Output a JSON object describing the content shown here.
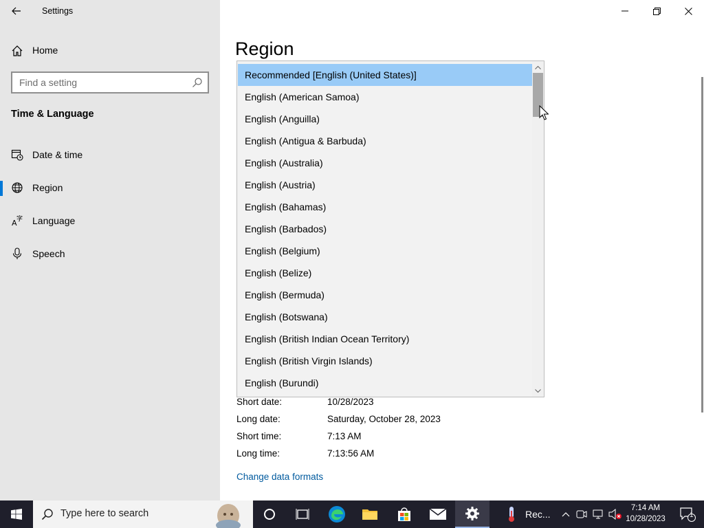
{
  "window": {
    "app_title": "Settings",
    "controls": {
      "minimize_icon": "minimize-icon",
      "maximize_icon": "restore-icon",
      "close_icon": "close-icon"
    }
  },
  "sidebar": {
    "home_label": "Home",
    "search_placeholder": "Find a setting",
    "section_title": "Time & Language",
    "items": [
      {
        "label": "Date & time",
        "icon": "calendar-clock-icon",
        "selected": false
      },
      {
        "label": "Region",
        "icon": "globe-icon",
        "selected": true
      },
      {
        "label": "Language",
        "icon": "language-icon",
        "selected": false
      },
      {
        "label": "Speech",
        "icon": "microphone-icon",
        "selected": false
      }
    ]
  },
  "main": {
    "page_title": "Region",
    "region_dropdown": {
      "selected_index": 0,
      "options": [
        "Recommended [English (United States)]",
        "English (American Samoa)",
        "English (Anguilla)",
        "English (Antigua & Barbuda)",
        "English (Australia)",
        "English (Austria)",
        "English (Bahamas)",
        "English (Barbados)",
        "English (Belgium)",
        "English (Belize)",
        "English (Bermuda)",
        "English (Botswana)",
        "English (British Indian Ocean Territory)",
        "English (British Virgin Islands)",
        "English (Burundi)"
      ]
    },
    "formats": [
      {
        "label": "Short date:",
        "value": "10/28/2023"
      },
      {
        "label": "Long date:",
        "value": "Saturday, October 28, 2023"
      },
      {
        "label": "Short time:",
        "value": "7:13 AM"
      },
      {
        "label": "Long time:",
        "value": "7:13:56 AM"
      }
    ],
    "change_link": "Change data formats"
  },
  "taskbar": {
    "search_placeholder": "Type here to search",
    "pinned": [
      "start-icon",
      "cortana-icon",
      "task-view-icon",
      "edge-icon",
      "file-explorer-icon",
      "store-icon",
      "mail-icon",
      "settings-icon"
    ],
    "running_app_label": "Rec...",
    "clock_time": "7:14 AM",
    "clock_date": "10/28/2023",
    "notification_count": "1",
    "colors": {
      "accent": "#0078d7",
      "taskbar": "#1f1f2b"
    }
  }
}
